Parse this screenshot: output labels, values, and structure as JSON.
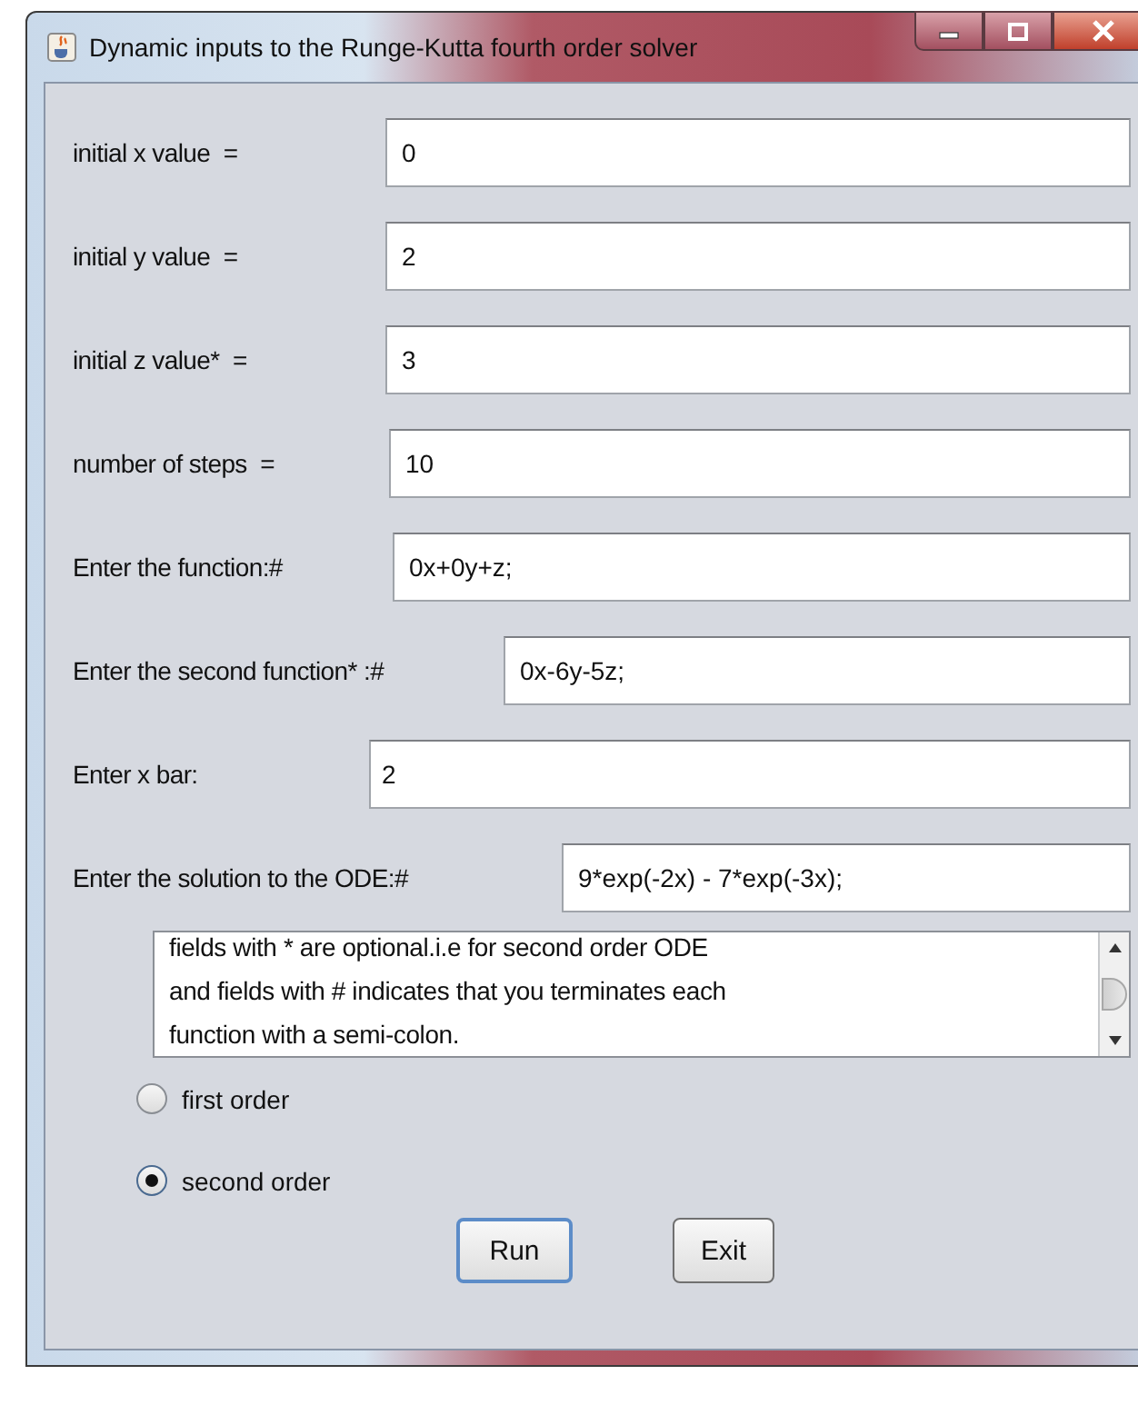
{
  "window": {
    "title": "Dynamic inputs to the Runge-Kutta fourth order solver"
  },
  "fields": [
    {
      "label": "initial x value  =",
      "value": "0"
    },
    {
      "label": "initial y value  =",
      "value": "2"
    },
    {
      "label": "initial z value*  =",
      "value": "3"
    },
    {
      "label": "number of steps  =",
      "value": "10"
    },
    {
      "label": "Enter the function:#",
      "value": "0x+0y+z;"
    },
    {
      "label": "Enter the second function* :#",
      "value": "0x-6y-5z;"
    },
    {
      "label": "Enter x bar:",
      "value": "2"
    },
    {
      "label": "Enter the solution to the ODE:#",
      "value": "9*exp(-2x) - 7*exp(-3x);"
    }
  ],
  "note": [
    "fields with * are optional.i.e for second order ODE",
    "and fields with # indicates that you terminates each",
    "function with a semi-colon."
  ],
  "radios": [
    {
      "label": "first order",
      "selected": false
    },
    {
      "label": "second order",
      "selected": true
    }
  ],
  "buttons": [
    "Run",
    "Exit"
  ]
}
